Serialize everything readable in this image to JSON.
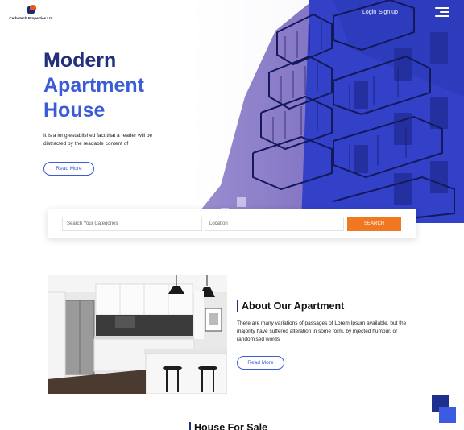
{
  "brand": {
    "name": "Cerbotech Properties Ltd."
  },
  "nav": {
    "login": "Login",
    "signup": "Sign up"
  },
  "hero": {
    "title_line1": "Modern",
    "title_line2": "Apartment",
    "title_line3": "House",
    "description": "It is a long established fact that a reader will be distracted by the readable content of",
    "button": "Read More"
  },
  "search": {
    "category_placeholder": "Search Your Categories",
    "location_placeholder": "Location",
    "button": "SEARCH"
  },
  "about": {
    "title": "About Our Apartment",
    "description": "There are many variations of passages of Lorem Ipsum available, but the majority have suffered alteration in some form, by injected humour, or randomised words",
    "button": "Read More"
  },
  "sale": {
    "title": "House For Sale"
  },
  "colors": {
    "primary": "#22307c",
    "accent": "#3c5bd6",
    "search_button": "#f07822"
  },
  "icons": {
    "menu": "hamburger-menu-icon",
    "logo": "logo-icon"
  }
}
